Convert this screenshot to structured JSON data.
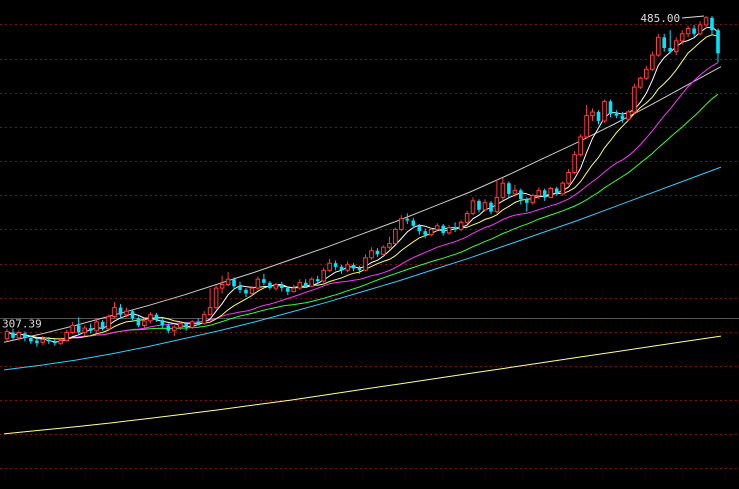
{
  "chart_data": {
    "type": "candlestick",
    "title": "",
    "xlabel": "",
    "ylabel": "",
    "annotations": {
      "high_label": "485.00",
      "low_label": "307.39"
    },
    "reference_level": 307.39,
    "ylim": [
      220,
      495
    ],
    "grid": true,
    "colors": {
      "background": "#000000",
      "up_candle": "#ff3b3b",
      "down_candle": "#00e5ff",
      "grid": "#7a1010",
      "ma5": "#ffffff",
      "ma10": "#ffff66",
      "ma20": "#ff33ff",
      "ma30": "#33ff33",
      "ma60": "#cccccc",
      "ma120": "#33ccff",
      "ma250": "#ffff99",
      "text": "#dddddd"
    },
    "indices": {
      "start": 0,
      "end": 119
    },
    "moving_average_series": [
      {
        "key": "ma60",
        "values": [
          302.5,
          307.0,
          312.0,
          317.5,
          323.0,
          329.0,
          335.5,
          342.0,
          349.0,
          356.0,
          363.5,
          371.0,
          379.0,
          387.0,
          396.0,
          405.5,
          415.0,
          425.0,
          435.5,
          446.5,
          457.5
        ]
      },
      {
        "key": "ma120",
        "values": [
          287.0,
          289.5,
          292.5,
          296.0,
          300.0,
          304.5,
          309.0,
          314.0,
          319.5,
          325.0,
          331.0,
          337.0,
          343.5,
          350.0,
          357.0,
          364.0,
          371.0,
          378.5,
          386.0,
          393.5,
          401.0
        ]
      },
      {
        "key": "ma250",
        "values": [
          251.0,
          253.0,
          255.0,
          257.2,
          259.6,
          262.0,
          264.6,
          267.3,
          270.0,
          273.0,
          276.0,
          279.0,
          282.0,
          285.0,
          288.0,
          291.0,
          294.0,
          297.0,
          300.0,
          303.0,
          306.0
        ]
      }
    ],
    "candles": [
      {
        "o": 304.5,
        "c": 308.5,
        "h": 310.0,
        "l": 303.0
      },
      {
        "o": 308.0,
        "c": 305.0,
        "h": 310.2,
        "l": 304.0
      },
      {
        "o": 305.0,
        "c": 308.0,
        "h": 309.0,
        "l": 303.5
      },
      {
        "o": 307.5,
        "c": 305.0,
        "h": 308.5,
        "l": 303.0
      },
      {
        "o": 305.0,
        "c": 303.0,
        "h": 306.5,
        "l": 301.5
      },
      {
        "o": 303.5,
        "c": 302.0,
        "h": 305.0,
        "l": 300.0
      },
      {
        "o": 302.5,
        "c": 304.0,
        "h": 306.0,
        "l": 301.0
      },
      {
        "o": 304.0,
        "c": 303.0,
        "h": 305.5,
        "l": 301.5
      },
      {
        "o": 303.0,
        "c": 302.0,
        "h": 304.5,
        "l": 300.5
      },
      {
        "o": 302.0,
        "c": 303.5,
        "h": 305.0,
        "l": 301.0
      },
      {
        "o": 303.5,
        "c": 308.0,
        "h": 309.5,
        "l": 303.0
      },
      {
        "o": 308.0,
        "c": 312.0,
        "h": 314.0,
        "l": 307.0
      },
      {
        "o": 312.0,
        "c": 308.0,
        "h": 316.5,
        "l": 307.0
      },
      {
        "o": 308.0,
        "c": 310.5,
        "h": 312.0,
        "l": 306.0
      },
      {
        "o": 310.5,
        "c": 309.0,
        "h": 313.0,
        "l": 307.5
      },
      {
        "o": 309.0,
        "c": 314.0,
        "h": 316.0,
        "l": 308.0
      },
      {
        "o": 314.0,
        "c": 310.0,
        "h": 315.0,
        "l": 309.0
      },
      {
        "o": 310.0,
        "c": 317.0,
        "h": 318.0,
        "l": 309.5
      },
      {
        "o": 317.0,
        "c": 322.0,
        "h": 325.0,
        "l": 316.0
      },
      {
        "o": 322.0,
        "c": 318.0,
        "h": 324.0,
        "l": 316.0
      },
      {
        "o": 318.0,
        "c": 320.0,
        "h": 322.0,
        "l": 316.5
      },
      {
        "o": 320.0,
        "c": 316.0,
        "h": 321.0,
        "l": 315.0
      },
      {
        "o": 316.0,
        "c": 312.0,
        "h": 317.0,
        "l": 311.0
      },
      {
        "o": 312.0,
        "c": 314.5,
        "h": 316.0,
        "l": 310.5
      },
      {
        "o": 314.5,
        "c": 318.0,
        "h": 319.5,
        "l": 313.0
      },
      {
        "o": 318.0,
        "c": 315.0,
        "h": 319.0,
        "l": 314.0
      },
      {
        "o": 315.0,
        "c": 312.0,
        "h": 316.0,
        "l": 310.5
      },
      {
        "o": 312.0,
        "c": 309.0,
        "h": 313.0,
        "l": 307.5
      },
      {
        "o": 309.0,
        "c": 311.0,
        "h": 312.0,
        "l": 306.0
      },
      {
        "o": 311.0,
        "c": 313.0,
        "h": 314.5,
        "l": 309.5
      },
      {
        "o": 313.0,
        "c": 311.0,
        "h": 314.0,
        "l": 309.0
      },
      {
        "o": 311.0,
        "c": 314.0,
        "h": 315.0,
        "l": 310.0
      },
      {
        "o": 314.0,
        "c": 313.0,
        "h": 316.0,
        "l": 312.0
      },
      {
        "o": 313.0,
        "c": 318.0,
        "h": 320.0,
        "l": 312.5
      },
      {
        "o": 318.0,
        "c": 322.0,
        "h": 333.0,
        "l": 317.5
      },
      {
        "o": 322.0,
        "c": 333.0,
        "h": 334.5,
        "l": 321.0
      },
      {
        "o": 333.0,
        "c": 335.0,
        "h": 340.0,
        "l": 330.0
      },
      {
        "o": 335.0,
        "c": 338.0,
        "h": 342.0,
        "l": 334.0
      },
      {
        "o": 338.0,
        "c": 334.0,
        "h": 339.0,
        "l": 332.0
      },
      {
        "o": 334.0,
        "c": 332.0,
        "h": 336.5,
        "l": 330.0
      },
      {
        "o": 332.0,
        "c": 330.0,
        "h": 333.0,
        "l": 328.0
      },
      {
        "o": 330.0,
        "c": 333.0,
        "h": 334.0,
        "l": 329.0
      },
      {
        "o": 333.0,
        "c": 338.0,
        "h": 339.5,
        "l": 332.0
      },
      {
        "o": 338.0,
        "c": 336.0,
        "h": 341.0,
        "l": 334.5
      },
      {
        "o": 336.0,
        "c": 333.0,
        "h": 337.0,
        "l": 332.0
      },
      {
        "o": 333.0,
        "c": 335.0,
        "h": 336.0,
        "l": 331.5
      },
      {
        "o": 335.0,
        "c": 333.0,
        "h": 336.5,
        "l": 331.0
      },
      {
        "o": 333.0,
        "c": 331.0,
        "h": 334.0,
        "l": 329.0
      },
      {
        "o": 331.0,
        "c": 333.0,
        "h": 335.0,
        "l": 330.5
      },
      {
        "o": 333.0,
        "c": 336.0,
        "h": 338.0,
        "l": 332.0
      },
      {
        "o": 336.0,
        "c": 334.0,
        "h": 338.0,
        "l": 333.0
      },
      {
        "o": 334.0,
        "c": 338.0,
        "h": 339.0,
        "l": 333.5
      },
      {
        "o": 338.0,
        "c": 337.0,
        "h": 340.0,
        "l": 335.5
      },
      {
        "o": 337.0,
        "c": 343.0,
        "h": 344.5,
        "l": 336.0
      },
      {
        "o": 343.0,
        "c": 347.0,
        "h": 349.5,
        "l": 342.0
      },
      {
        "o": 347.0,
        "c": 345.0,
        "h": 348.5,
        "l": 343.0
      },
      {
        "o": 345.0,
        "c": 343.0,
        "h": 346.0,
        "l": 341.0
      },
      {
        "o": 343.0,
        "c": 346.0,
        "h": 348.0,
        "l": 342.0
      },
      {
        "o": 346.0,
        "c": 344.0,
        "h": 347.0,
        "l": 342.5
      },
      {
        "o": 344.0,
        "c": 343.0,
        "h": 345.5,
        "l": 341.0
      },
      {
        "o": 343.0,
        "c": 350.0,
        "h": 352.0,
        "l": 342.5
      },
      {
        "o": 350.0,
        "c": 354.0,
        "h": 356.0,
        "l": 349.0
      },
      {
        "o": 354.0,
        "c": 352.0,
        "h": 355.5,
        "l": 350.5
      },
      {
        "o": 352.0,
        "c": 356.0,
        "h": 357.0,
        "l": 351.0
      },
      {
        "o": 356.0,
        "c": 358.0,
        "h": 362.0,
        "l": 355.0
      },
      {
        "o": 358.0,
        "c": 366.0,
        "h": 367.0,
        "l": 357.5
      },
      {
        "o": 366.0,
        "c": 372.0,
        "h": 374.0,
        "l": 365.0
      },
      {
        "o": 372.0,
        "c": 371.0,
        "h": 375.0,
        "l": 369.0
      },
      {
        "o": 371.0,
        "c": 368.0,
        "h": 372.5,
        "l": 366.5
      },
      {
        "o": 368.0,
        "c": 365.0,
        "h": 369.0,
        "l": 363.0
      },
      {
        "o": 365.0,
        "c": 363.0,
        "h": 366.5,
        "l": 361.0
      },
      {
        "o": 363.0,
        "c": 366.0,
        "h": 367.0,
        "l": 362.0
      },
      {
        "o": 366.0,
        "c": 368.0,
        "h": 369.5,
        "l": 365.0
      },
      {
        "o": 368.0,
        "c": 364.0,
        "h": 369.0,
        "l": 362.5
      },
      {
        "o": 364.0,
        "c": 367.0,
        "h": 368.5,
        "l": 363.0
      },
      {
        "o": 367.0,
        "c": 366.0,
        "h": 370.0,
        "l": 364.5
      },
      {
        "o": 366.0,
        "c": 370.0,
        "h": 371.0,
        "l": 365.0
      },
      {
        "o": 370.0,
        "c": 375.0,
        "h": 376.5,
        "l": 369.0
      },
      {
        "o": 375.0,
        "c": 382.0,
        "h": 384.0,
        "l": 374.0
      },
      {
        "o": 382.0,
        "c": 377.0,
        "h": 383.0,
        "l": 375.5
      },
      {
        "o": 377.0,
        "c": 381.0,
        "h": 383.0,
        "l": 376.0
      },
      {
        "o": 381.0,
        "c": 376.0,
        "h": 382.0,
        "l": 374.5
      },
      {
        "o": 376.0,
        "c": 384.0,
        "h": 394.0,
        "l": 375.0
      },
      {
        "o": 384.0,
        "c": 392.0,
        "h": 395.0,
        "l": 382.5
      },
      {
        "o": 392.0,
        "c": 386.0,
        "h": 393.0,
        "l": 384.0
      },
      {
        "o": 386.0,
        "c": 388.0,
        "h": 391.0,
        "l": 384.5
      },
      {
        "o": 388.0,
        "c": 383.0,
        "h": 389.0,
        "l": 380.0
      },
      {
        "o": 383.0,
        "c": 381.0,
        "h": 384.0,
        "l": 376.0
      },
      {
        "o": 381.0,
        "c": 385.0,
        "h": 386.0,
        "l": 380.0
      },
      {
        "o": 385.0,
        "c": 388.0,
        "h": 389.5,
        "l": 383.0
      },
      {
        "o": 388.0,
        "c": 384.0,
        "h": 389.0,
        "l": 382.0
      },
      {
        "o": 384.0,
        "c": 389.0,
        "h": 390.0,
        "l": 383.5
      },
      {
        "o": 389.0,
        "c": 386.0,
        "h": 390.0,
        "l": 385.0
      },
      {
        "o": 386.0,
        "c": 392.0,
        "h": 393.0,
        "l": 385.0
      },
      {
        "o": 392.0,
        "c": 398.0,
        "h": 400.0,
        "l": 391.0
      },
      {
        "o": 398.0,
        "c": 408.0,
        "h": 410.0,
        "l": 397.0
      },
      {
        "o": 408.0,
        "c": 418.0,
        "h": 419.5,
        "l": 407.0
      },
      {
        "o": 418.0,
        "c": 430.0,
        "h": 436.0,
        "l": 417.0
      },
      {
        "o": 430.0,
        "c": 432.0,
        "h": 434.0,
        "l": 427.0
      },
      {
        "o": 432.0,
        "c": 427.0,
        "h": 433.0,
        "l": 425.0
      },
      {
        "o": 427.0,
        "c": 438.0,
        "h": 439.0,
        "l": 426.0
      },
      {
        "o": 438.0,
        "c": 431.0,
        "h": 439.0,
        "l": 429.0
      },
      {
        "o": 431.0,
        "c": 430.0,
        "h": 433.0,
        "l": 428.5
      },
      {
        "o": 430.0,
        "c": 428.0,
        "h": 432.0,
        "l": 426.0
      },
      {
        "o": 428.0,
        "c": 432.0,
        "h": 433.0,
        "l": 427.0
      },
      {
        "o": 432.0,
        "c": 446.0,
        "h": 448.0,
        "l": 431.0
      },
      {
        "o": 446.0,
        "c": 451.0,
        "h": 452.0,
        "l": 445.0
      },
      {
        "o": 451.0,
        "c": 456.0,
        "h": 458.0,
        "l": 450.0
      },
      {
        "o": 456.0,
        "c": 464.0,
        "h": 466.0,
        "l": 455.0
      },
      {
        "o": 464.0,
        "c": 474.0,
        "h": 476.0,
        "l": 463.0
      },
      {
        "o": 474.0,
        "c": 468.0,
        "h": 476.0,
        "l": 466.0
      },
      {
        "o": 468.0,
        "c": 466.0,
        "h": 478.0,
        "l": 465.0
      },
      {
        "o": 466.0,
        "c": 472.0,
        "h": 474.0,
        "l": 464.0
      },
      {
        "o": 472.0,
        "c": 476.0,
        "h": 478.0,
        "l": 470.0
      },
      {
        "o": 476.0,
        "c": 479.0,
        "h": 480.5,
        "l": 474.0
      },
      {
        "o": 479.0,
        "c": 476.0,
        "h": 481.0,
        "l": 474.5
      },
      {
        "o": 476.0,
        "c": 481.0,
        "h": 483.0,
        "l": 475.0
      },
      {
        "o": 481.0,
        "c": 485.0,
        "h": 486.0,
        "l": 479.0
      },
      {
        "o": 485.0,
        "c": 478.0,
        "h": 486.0,
        "l": 475.0
      },
      {
        "o": 478.0,
        "c": 465.0,
        "h": 479.0,
        "l": 460.0
      }
    ]
  }
}
